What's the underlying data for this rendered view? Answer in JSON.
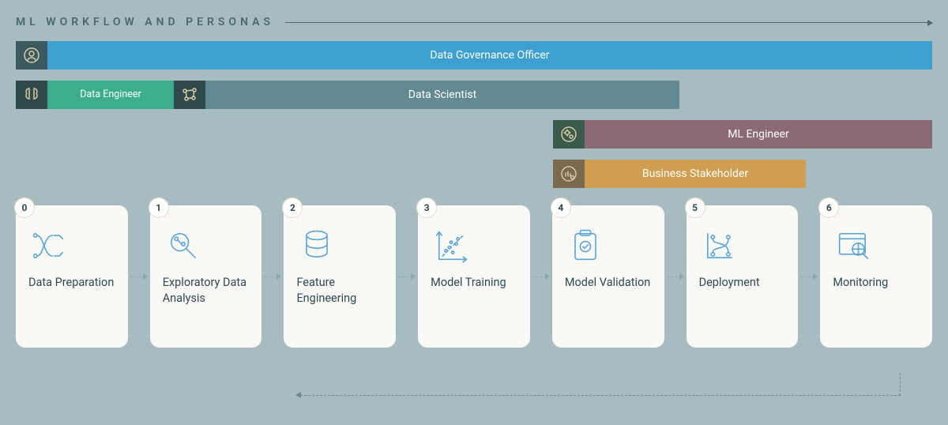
{
  "header": {
    "title": "ML WORKFLOW AND PERSONAS"
  },
  "personas": {
    "governance": {
      "label": "Data Governance Officer",
      "icon": "governance-icon",
      "span_cols": [
        0,
        6
      ]
    },
    "engineer": {
      "label": "Data Engineer",
      "icon": "brain-icon",
      "span_cols": [
        0,
        0
      ]
    },
    "scientist": {
      "label": "Data Scientist",
      "icon": "network-icon",
      "span_cols": [
        1,
        4
      ]
    },
    "mle": {
      "label": "ML Engineer",
      "icon": "gears-icon",
      "span_cols": [
        4,
        6
      ]
    },
    "business": {
      "label": "Business Stakeholder",
      "icon": "chart-user-icon",
      "span_cols": [
        4,
        5
      ]
    }
  },
  "workflow": [
    {
      "num": "0",
      "label": "Data Preparation",
      "icon": "pipeline-icon"
    },
    {
      "num": "1",
      "label": "Exploratory Data Analysis",
      "icon": "analysis-icon"
    },
    {
      "num": "2",
      "label": "Feature Engineering",
      "icon": "database-icon"
    },
    {
      "num": "3",
      "label": "Model Training",
      "icon": "scatter-icon"
    },
    {
      "num": "4",
      "label": "Model Validation",
      "icon": "checklist-icon"
    },
    {
      "num": "5",
      "label": "Deployment",
      "icon": "deploy-icon"
    },
    {
      "num": "6",
      "label": "Monitoring",
      "icon": "monitor-icon"
    }
  ]
}
